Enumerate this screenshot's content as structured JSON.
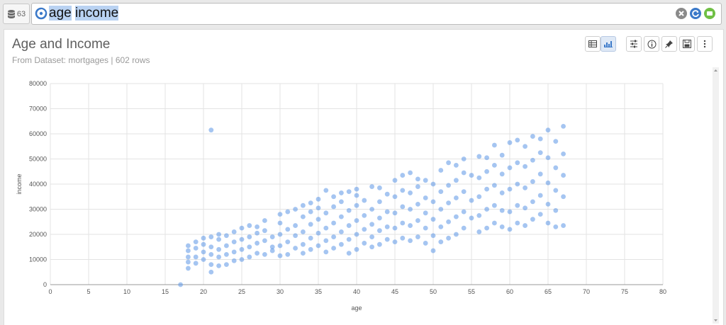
{
  "top": {
    "dataset_count": "63",
    "search_query_words": [
      "age",
      "income"
    ]
  },
  "panel": {
    "title": "Age and Income",
    "subtitle": "From Dataset: mortgages | 602 rows"
  },
  "icons": {
    "table": "table-icon",
    "bar": "bar-chart-icon",
    "settings": "sliders-icon",
    "info": "info-icon",
    "pin": "pin-icon",
    "save": "save-icon",
    "more": "more-vertical-icon"
  },
  "colors": {
    "point": "#5b95e6",
    "accent": "#3b79c9"
  },
  "chart_data": {
    "type": "scatter",
    "xlabel": "age",
    "ylabel": "income",
    "xlim": [
      0,
      80
    ],
    "ylim": [
      0,
      80000
    ],
    "xticks": [
      "0",
      "5",
      "10",
      "15",
      "20",
      "25",
      "30",
      "35",
      "40",
      "45",
      "50",
      "55",
      "60",
      "65",
      "70",
      "75",
      "80"
    ],
    "yticks": [
      "0",
      "10000",
      "20000",
      "30000",
      "40000",
      "50000",
      "60000",
      "70000",
      "80000"
    ],
    "grid": true,
    "points": [
      [
        17,
        0
      ],
      [
        21,
        61500
      ],
      [
        18,
        6500
      ],
      [
        18,
        9000
      ],
      [
        18,
        11000
      ],
      [
        18,
        13500
      ],
      [
        18,
        15500
      ],
      [
        19,
        8500
      ],
      [
        19,
        11000
      ],
      [
        19,
        14500
      ],
      [
        19,
        17000
      ],
      [
        20,
        10000
      ],
      [
        20,
        13000
      ],
      [
        20,
        16000
      ],
      [
        20,
        18500
      ],
      [
        21,
        5000
      ],
      [
        21,
        8000
      ],
      [
        21,
        12000
      ],
      [
        21,
        15000
      ],
      [
        21,
        19000
      ],
      [
        22,
        7500
      ],
      [
        22,
        11000
      ],
      [
        22,
        14000
      ],
      [
        22,
        18000
      ],
      [
        22,
        20000
      ],
      [
        23,
        8000
      ],
      [
        23,
        12000
      ],
      [
        23,
        15500
      ],
      [
        23,
        19500
      ],
      [
        24,
        9500
      ],
      [
        24,
        13000
      ],
      [
        24,
        17000
      ],
      [
        24,
        21000
      ],
      [
        25,
        10000
      ],
      [
        25,
        14000
      ],
      [
        25,
        18000
      ],
      [
        25,
        22500
      ],
      [
        26,
        11000
      ],
      [
        26,
        15000
      ],
      [
        26,
        19000
      ],
      [
        26,
        23500
      ],
      [
        27,
        12500
      ],
      [
        27,
        16500
      ],
      [
        27,
        20500
      ],
      [
        27,
        23000
      ],
      [
        28,
        12000
      ],
      [
        28,
        17500
      ],
      [
        28,
        21500
      ],
      [
        28,
        25500
      ],
      [
        29,
        13500
      ],
      [
        29,
        15000
      ],
      [
        29,
        19000
      ],
      [
        30,
        11500
      ],
      [
        30,
        15500
      ],
      [
        30,
        20000
      ],
      [
        30,
        24500
      ],
      [
        30,
        28000
      ],
      [
        31,
        12000
      ],
      [
        31,
        17000
      ],
      [
        31,
        22000
      ],
      [
        31,
        29000
      ],
      [
        32,
        14500
      ],
      [
        32,
        19500
      ],
      [
        32,
        23500
      ],
      [
        32,
        30000
      ],
      [
        33,
        12500
      ],
      [
        33,
        16000
      ],
      [
        33,
        21000
      ],
      [
        33,
        27000
      ],
      [
        33,
        31500
      ],
      [
        34,
        14000
      ],
      [
        34,
        18500
      ],
      [
        34,
        24000
      ],
      [
        34,
        29000
      ],
      [
        34,
        32500
      ],
      [
        35,
        15500
      ],
      [
        35,
        20500
      ],
      [
        35,
        26000
      ],
      [
        35,
        30500
      ],
      [
        35,
        34000
      ],
      [
        36,
        13000
      ],
      [
        36,
        17500
      ],
      [
        36,
        22500
      ],
      [
        36,
        28500
      ],
      [
        36,
        37500
      ],
      [
        37,
        14500
      ],
      [
        37,
        19000
      ],
      [
        37,
        24500
      ],
      [
        37,
        31000
      ],
      [
        37,
        35000
      ],
      [
        38,
        16000
      ],
      [
        38,
        21000
      ],
      [
        38,
        27000
      ],
      [
        38,
        33000
      ],
      [
        38,
        36500
      ],
      [
        39,
        12500
      ],
      [
        39,
        18000
      ],
      [
        39,
        23500
      ],
      [
        39,
        29500
      ],
      [
        39,
        37000
      ],
      [
        40,
        14000
      ],
      [
        40,
        20000
      ],
      [
        40,
        25500
      ],
      [
        40,
        31500
      ],
      [
        40,
        35500
      ],
      [
        40,
        38000
      ],
      [
        41,
        16500
      ],
      [
        41,
        22000
      ],
      [
        41,
        27500
      ],
      [
        41,
        33500
      ],
      [
        42,
        15000
      ],
      [
        42,
        19000
      ],
      [
        42,
        24000
      ],
      [
        42,
        30000
      ],
      [
        42,
        39000
      ],
      [
        43,
        16000
      ],
      [
        43,
        21500
      ],
      [
        43,
        26500
      ],
      [
        43,
        33000
      ],
      [
        43,
        38500
      ],
      [
        44,
        18000
      ],
      [
        44,
        23000
      ],
      [
        44,
        29000
      ],
      [
        44,
        36000
      ],
      [
        45,
        17000
      ],
      [
        45,
        22500
      ],
      [
        45,
        28500
      ],
      [
        45,
        35000
      ],
      [
        45,
        41500
      ],
      [
        46,
        18500
      ],
      [
        46,
        24500
      ],
      [
        46,
        31000
      ],
      [
        46,
        37500
      ],
      [
        46,
        43500
      ],
      [
        47,
        17500
      ],
      [
        47,
        23500
      ],
      [
        47,
        30000
      ],
      [
        47,
        36500
      ],
      [
        47,
        44500
      ],
      [
        48,
        19000
      ],
      [
        48,
        25500
      ],
      [
        48,
        32000
      ],
      [
        48,
        39000
      ],
      [
        48,
        42000
      ],
      [
        49,
        16500
      ],
      [
        49,
        22500
      ],
      [
        49,
        28500
      ],
      [
        49,
        34500
      ],
      [
        49,
        41500
      ],
      [
        50,
        13500
      ],
      [
        50,
        19500
      ],
      [
        50,
        26000
      ],
      [
        50,
        33000
      ],
      [
        50,
        40000
      ],
      [
        51,
        17000
      ],
      [
        51,
        23000
      ],
      [
        51,
        30000
      ],
      [
        51,
        37000
      ],
      [
        51,
        45500
      ],
      [
        52,
        18500
      ],
      [
        52,
        25000
      ],
      [
        52,
        32500
      ],
      [
        52,
        39500
      ],
      [
        52,
        48500
      ],
      [
        53,
        20000
      ],
      [
        53,
        27000
      ],
      [
        53,
        34500
      ],
      [
        53,
        41500
      ],
      [
        53,
        47500
      ],
      [
        54,
        22500
      ],
      [
        54,
        29000
      ],
      [
        54,
        37000
      ],
      [
        54,
        44500
      ],
      [
        54,
        50000
      ],
      [
        55,
        26500
      ],
      [
        55,
        33500
      ],
      [
        55,
        43500
      ],
      [
        56,
        21000
      ],
      [
        56,
        27500
      ],
      [
        56,
        35000
      ],
      [
        56,
        42500
      ],
      [
        56,
        51000
      ],
      [
        57,
        22500
      ],
      [
        57,
        30000
      ],
      [
        57,
        38000
      ],
      [
        57,
        45000
      ],
      [
        57,
        50500
      ],
      [
        58,
        24500
      ],
      [
        58,
        31500
      ],
      [
        58,
        39500
      ],
      [
        58,
        47500
      ],
      [
        58,
        55500
      ],
      [
        59,
        23000
      ],
      [
        59,
        29500
      ],
      [
        59,
        36500
      ],
      [
        59,
        44000
      ],
      [
        59,
        51500
      ],
      [
        60,
        22000
      ],
      [
        60,
        29000
      ],
      [
        60,
        38000
      ],
      [
        60,
        46500
      ],
      [
        60,
        56500
      ],
      [
        61,
        24500
      ],
      [
        61,
        31500
      ],
      [
        61,
        40000
      ],
      [
        61,
        48500
      ],
      [
        61,
        57500
      ],
      [
        62,
        23500
      ],
      [
        62,
        30500
      ],
      [
        62,
        38500
      ],
      [
        62,
        47000
      ],
      [
        62,
        55000
      ],
      [
        63,
        26000
      ],
      [
        63,
        33000
      ],
      [
        63,
        41000
      ],
      [
        63,
        49500
      ],
      [
        63,
        59000
      ],
      [
        64,
        28000
      ],
      [
        64,
        35500
      ],
      [
        64,
        44000
      ],
      [
        64,
        52500
      ],
      [
        64,
        58000
      ],
      [
        65,
        24500
      ],
      [
        65,
        32000
      ],
      [
        65,
        40500
      ],
      [
        65,
        50500
      ],
      [
        65,
        61500
      ],
      [
        66,
        23000
      ],
      [
        66,
        29500
      ],
      [
        66,
        37500
      ],
      [
        66,
        46500
      ],
      [
        66,
        57000
      ],
      [
        67,
        23500
      ],
      [
        67,
        35000
      ],
      [
        67,
        43500
      ],
      [
        67,
        52000
      ],
      [
        67,
        63000
      ]
    ]
  }
}
